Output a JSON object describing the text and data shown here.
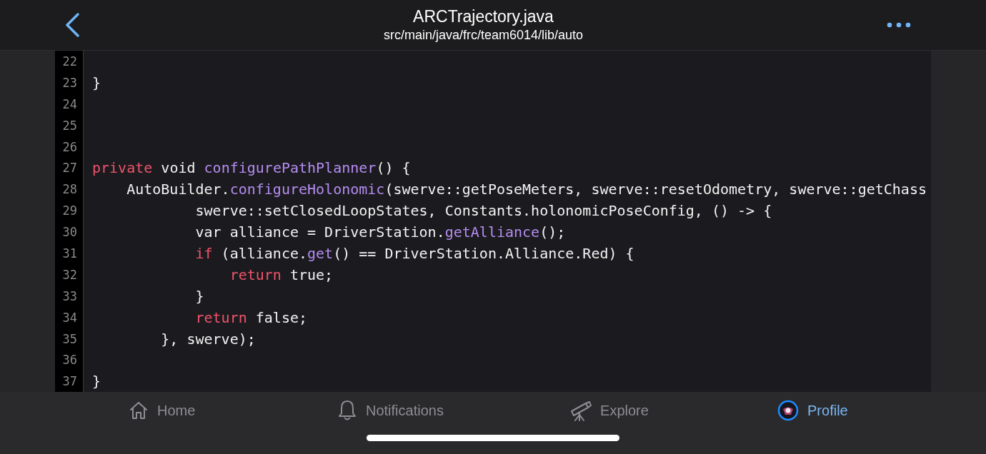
{
  "header": {
    "title": "ARCTrajectory.java",
    "path": "src/main/java/frc/team6014/lib/auto"
  },
  "code_lines": [
    {
      "number": "22"
    },
    {
      "number": "23",
      "tokens": [
        {
          "text": "}",
          "kind": "plain"
        }
      ]
    },
    {
      "number": "24"
    },
    {
      "number": "25"
    },
    {
      "number": "26"
    },
    {
      "number": "27",
      "tokens": [
        {
          "text": "private",
          "kind": "keyword"
        },
        {
          "text": " void ",
          "kind": "plain"
        },
        {
          "text": "configurePathPlanner",
          "kind": "method"
        },
        {
          "text": "() {",
          "kind": "plain"
        }
      ]
    },
    {
      "number": "28",
      "tokens": [
        {
          "text": "    AutoBuilder.",
          "kind": "plain"
        },
        {
          "text": "configureHolonomic",
          "kind": "method"
        },
        {
          "text": "(swerve::getPoseMeters, swerve::resetOdometry, swerve::getChass",
          "kind": "plain"
        }
      ]
    },
    {
      "number": "29",
      "tokens": [
        {
          "text": "            swerve::setClosedLoopStates, Constants.holonomicPoseConfig, () -> {",
          "kind": "plain"
        }
      ]
    },
    {
      "number": "30",
      "tokens": [
        {
          "text": "            var alliance = DriverStation.",
          "kind": "plain"
        },
        {
          "text": "getAlliance",
          "kind": "method"
        },
        {
          "text": "();",
          "kind": "plain"
        }
      ]
    },
    {
      "number": "31",
      "tokens": [
        {
          "text": "            if",
          "kind": "keyword"
        },
        {
          "text": " (alliance.",
          "kind": "plain"
        },
        {
          "text": "get",
          "kind": "method"
        },
        {
          "text": "() == DriverStation.Alliance.Red) {",
          "kind": "plain"
        }
      ]
    },
    {
      "number": "32",
      "tokens": [
        {
          "text": "                return",
          "kind": "keyword"
        },
        {
          "text": " true;",
          "kind": "plain"
        }
      ]
    },
    {
      "number": "33",
      "tokens": [
        {
          "text": "            }",
          "kind": "plain"
        }
      ]
    },
    {
      "number": "34",
      "tokens": [
        {
          "text": "            return",
          "kind": "keyword"
        },
        {
          "text": " false;",
          "kind": "plain"
        }
      ]
    },
    {
      "number": "35",
      "tokens": [
        {
          "text": "        }, swerve);",
          "kind": "plain"
        }
      ]
    },
    {
      "number": "36"
    },
    {
      "number": "37",
      "tokens": [
        {
          "text": "}",
          "kind": "plain"
        }
      ]
    }
  ],
  "tab_bar": [
    {
      "label": "Home",
      "kind": "home",
      "selected": false
    },
    {
      "label": "Notifications",
      "kind": "bell",
      "selected": false
    },
    {
      "label": "Explore",
      "kind": "telescope",
      "selected": false
    },
    {
      "label": "Profile",
      "kind": "avatar",
      "selected": true
    }
  ]
}
